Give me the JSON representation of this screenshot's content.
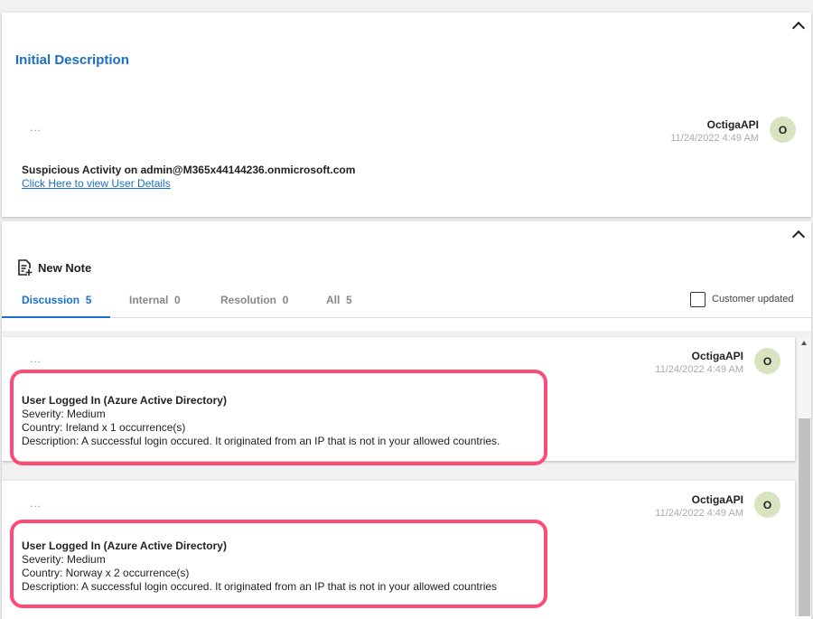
{
  "initial": {
    "title": "Initial Description",
    "dots": "...",
    "author": "OctigaAPI",
    "date": "11/24/2022 4:49 AM",
    "avatar": "O",
    "headline": "Suspicious Activity on admin@M365x44144236.onmicrosoft.com",
    "link": "Click Here to view User Details"
  },
  "notes_panel": {
    "new_note": "New Note",
    "tabs": [
      {
        "label": "Discussion",
        "count": "5"
      },
      {
        "label": "Internal",
        "count": "0"
      },
      {
        "label": "Resolution",
        "count": "0"
      },
      {
        "label": "All",
        "count": "5"
      }
    ],
    "customer_updated": "Customer updated"
  },
  "notes": [
    {
      "dots": "...",
      "author": "OctigaAPI",
      "date": "11/24/2022 4:49 AM",
      "avatar": "O",
      "title": "User Logged In (Azure Active Directory)",
      "severity": "Severity: Medium",
      "country": "Country: Ireland x 1 occurrence(s)",
      "description": "Description: A successful login occured. It originated from an IP that is not in your allowed countries."
    },
    {
      "dots": "...",
      "author": "OctigaAPI",
      "date": "11/24/2022 4:49 AM",
      "avatar": "O",
      "title": "User Logged In (Azure Active Directory)",
      "severity": "Severity: Medium",
      "country": "Country: Norway x 2 occurrence(s)",
      "description": "Description: A successful login occured. It originated from an IP that is not in your allowed countries"
    }
  ],
  "colors": {
    "accent": "#1a6fc9",
    "highlight": "#ff4a75",
    "avatar": "#d8e4c0"
  }
}
